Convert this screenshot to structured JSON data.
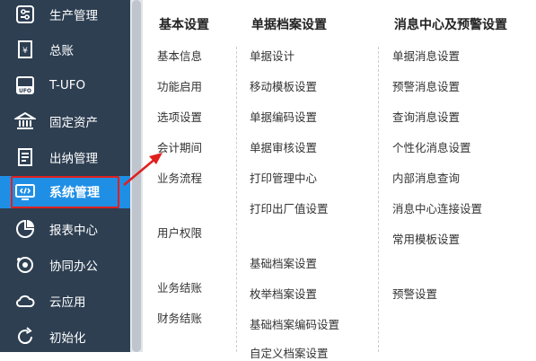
{
  "sidebar": {
    "items": [
      {
        "label": "生产管理",
        "icon": "production-icon"
      },
      {
        "label": "总账",
        "icon": "ledger-icon"
      },
      {
        "label": "T-UFO",
        "icon": "ufo-icon"
      },
      {
        "label": "固定资产",
        "icon": "bank-icon"
      },
      {
        "label": "出纳管理",
        "icon": "cashier-icon"
      },
      {
        "label": "系统管理",
        "icon": "system-icon",
        "active": true
      },
      {
        "label": "报表中心",
        "icon": "pie-chart-icon"
      },
      {
        "label": "协同办公",
        "icon": "collaboration-icon"
      },
      {
        "label": "云应用",
        "icon": "cloud-icon"
      },
      {
        "label": "初始化",
        "icon": "refresh-icon"
      }
    ]
  },
  "menu": {
    "col1": {
      "title": "基本设置",
      "items": [
        "基本信息",
        "功能启用",
        "选项设置",
        "会计期间",
        "业务流程",
        "用户权限",
        "业务结账",
        "财务结账"
      ]
    },
    "col2": {
      "title": "单据档案设置",
      "items": [
        "单据设计",
        "移动模板设置",
        "单据编码设置",
        "单据审核设置",
        "打印管理中心",
        "打印出厂值设置",
        "基础档案设置",
        "枚举档案设置",
        "基础档案编码设置",
        "自定义档案设置"
      ]
    },
    "col3": {
      "title": "消息中心及预警设置",
      "items": [
        "单据消息设置",
        "预警消息设置",
        "查询消息设置",
        "个性化消息设置",
        "内部消息查询",
        "消息中心连接设置",
        "常用模板设置",
        "预警设置"
      ]
    }
  },
  "colors": {
    "sidebar_bg": "#2e3f52",
    "active_bg": "#1f8fe6",
    "highlight": "#e0201e"
  }
}
